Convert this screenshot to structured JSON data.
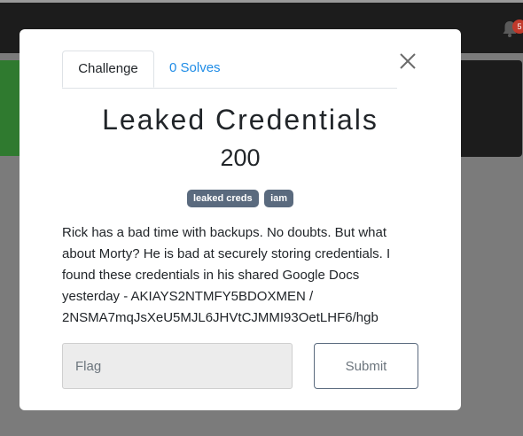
{
  "navbar": {
    "notification_count": "5"
  },
  "modal": {
    "tabs": [
      {
        "label": "Challenge",
        "active": true
      },
      {
        "label": "0 Solves",
        "active": false
      }
    ],
    "title": "Leaked Credentials",
    "points": "200",
    "tags": [
      "leaked creds",
      "iam"
    ],
    "description": "Rick has a bad time with backups. No doubts. But what about Morty? He is bad at securely storing credentials. I found these credentials in his shared Google Docs yesterday - AKIAYS2NTMFY5BDOXMEN / 2NSMA7mqJsXeU5MJL6JHVtCJMMI93OetLHF6/hgb",
    "flag_input": {
      "placeholder": "Flag",
      "value": ""
    },
    "submit_label": "Submit"
  },
  "colors": {
    "accent": "#1f8ce6",
    "tag_bg": "#5a6a7e",
    "navbar_bg": "#1c1c1c",
    "backdrop": "#7b7b7b"
  },
  "icons": {
    "close": "close-icon",
    "bell": "bell-icon"
  }
}
